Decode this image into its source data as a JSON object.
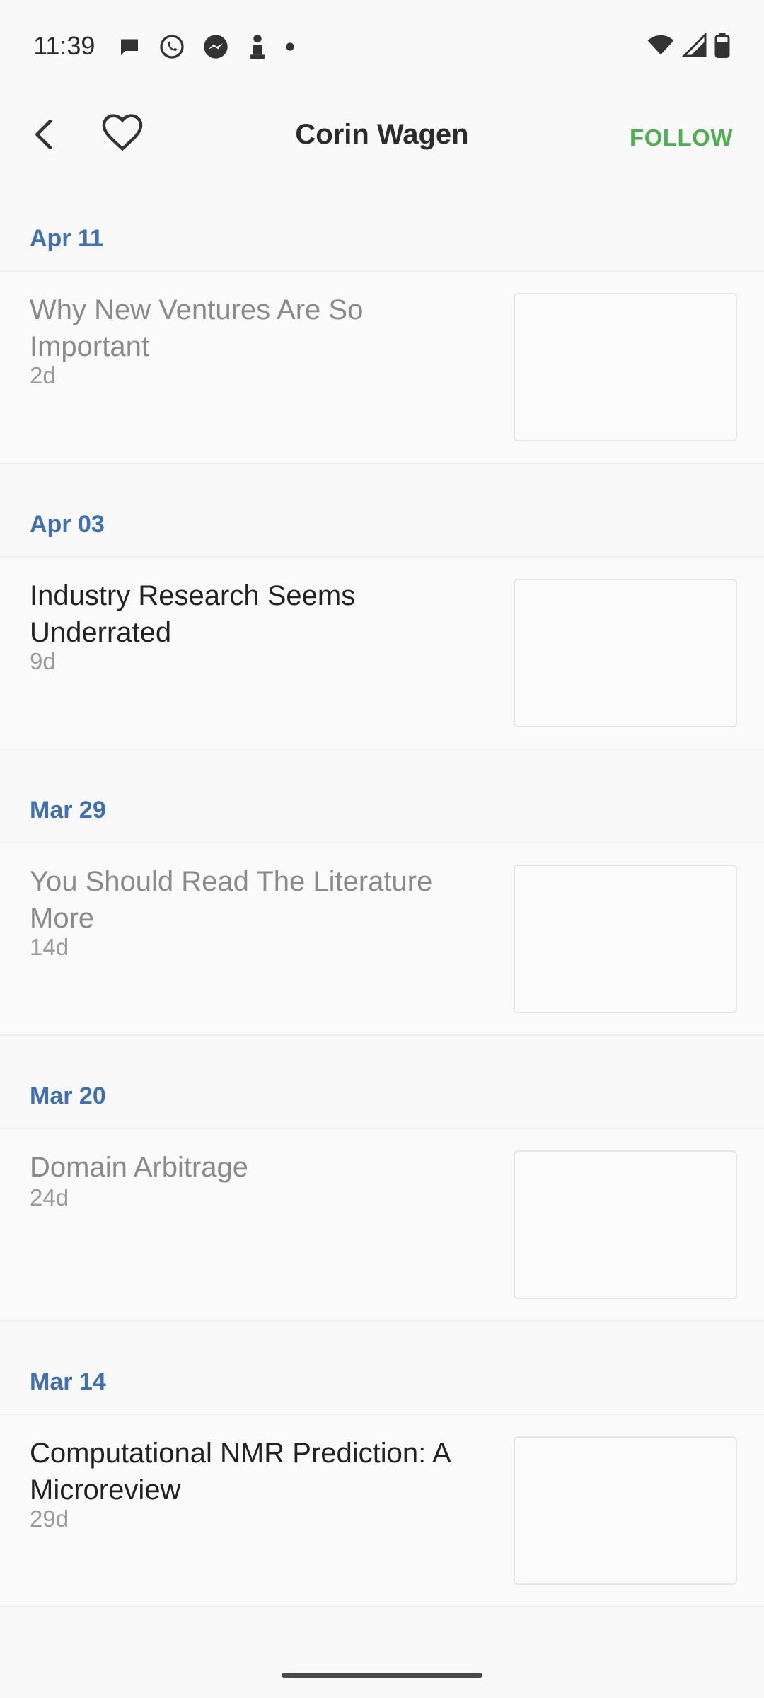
{
  "status_bar": {
    "time": "11:39",
    "notification_icons": [
      "chat-bubble-icon",
      "whatsapp-icon",
      "messenger-icon",
      "chess-pawn-icon",
      "dot-icon"
    ],
    "right_icons": [
      "wifi-icon",
      "signal-icon",
      "battery-icon"
    ]
  },
  "app_bar": {
    "title": "Corin Wagen",
    "follow_label": "FOLLOW",
    "back_icon": "chevron-left-icon",
    "favorite_icon": "heart-outline-icon",
    "accent_color": "#4caf50"
  },
  "feed": {
    "date_color": "#3f6fb5",
    "groups": [
      {
        "date": "Apr 11",
        "title": "Why New Ventures Are So Important",
        "age": "2d",
        "read": true
      },
      {
        "date": "Apr 03",
        "title": "Industry Research Seems Underrated",
        "age": "9d",
        "read": false
      },
      {
        "date": "Mar 29",
        "title": "You Should Read The Literature More",
        "age": "14d",
        "read": true
      },
      {
        "date": "Mar 20",
        "title": "Domain Arbitrage",
        "age": "24d",
        "read": true
      },
      {
        "date": "Mar 14",
        "title": "Computational NMR Prediction: A Microreview",
        "age": "29d",
        "read": false
      }
    ]
  }
}
